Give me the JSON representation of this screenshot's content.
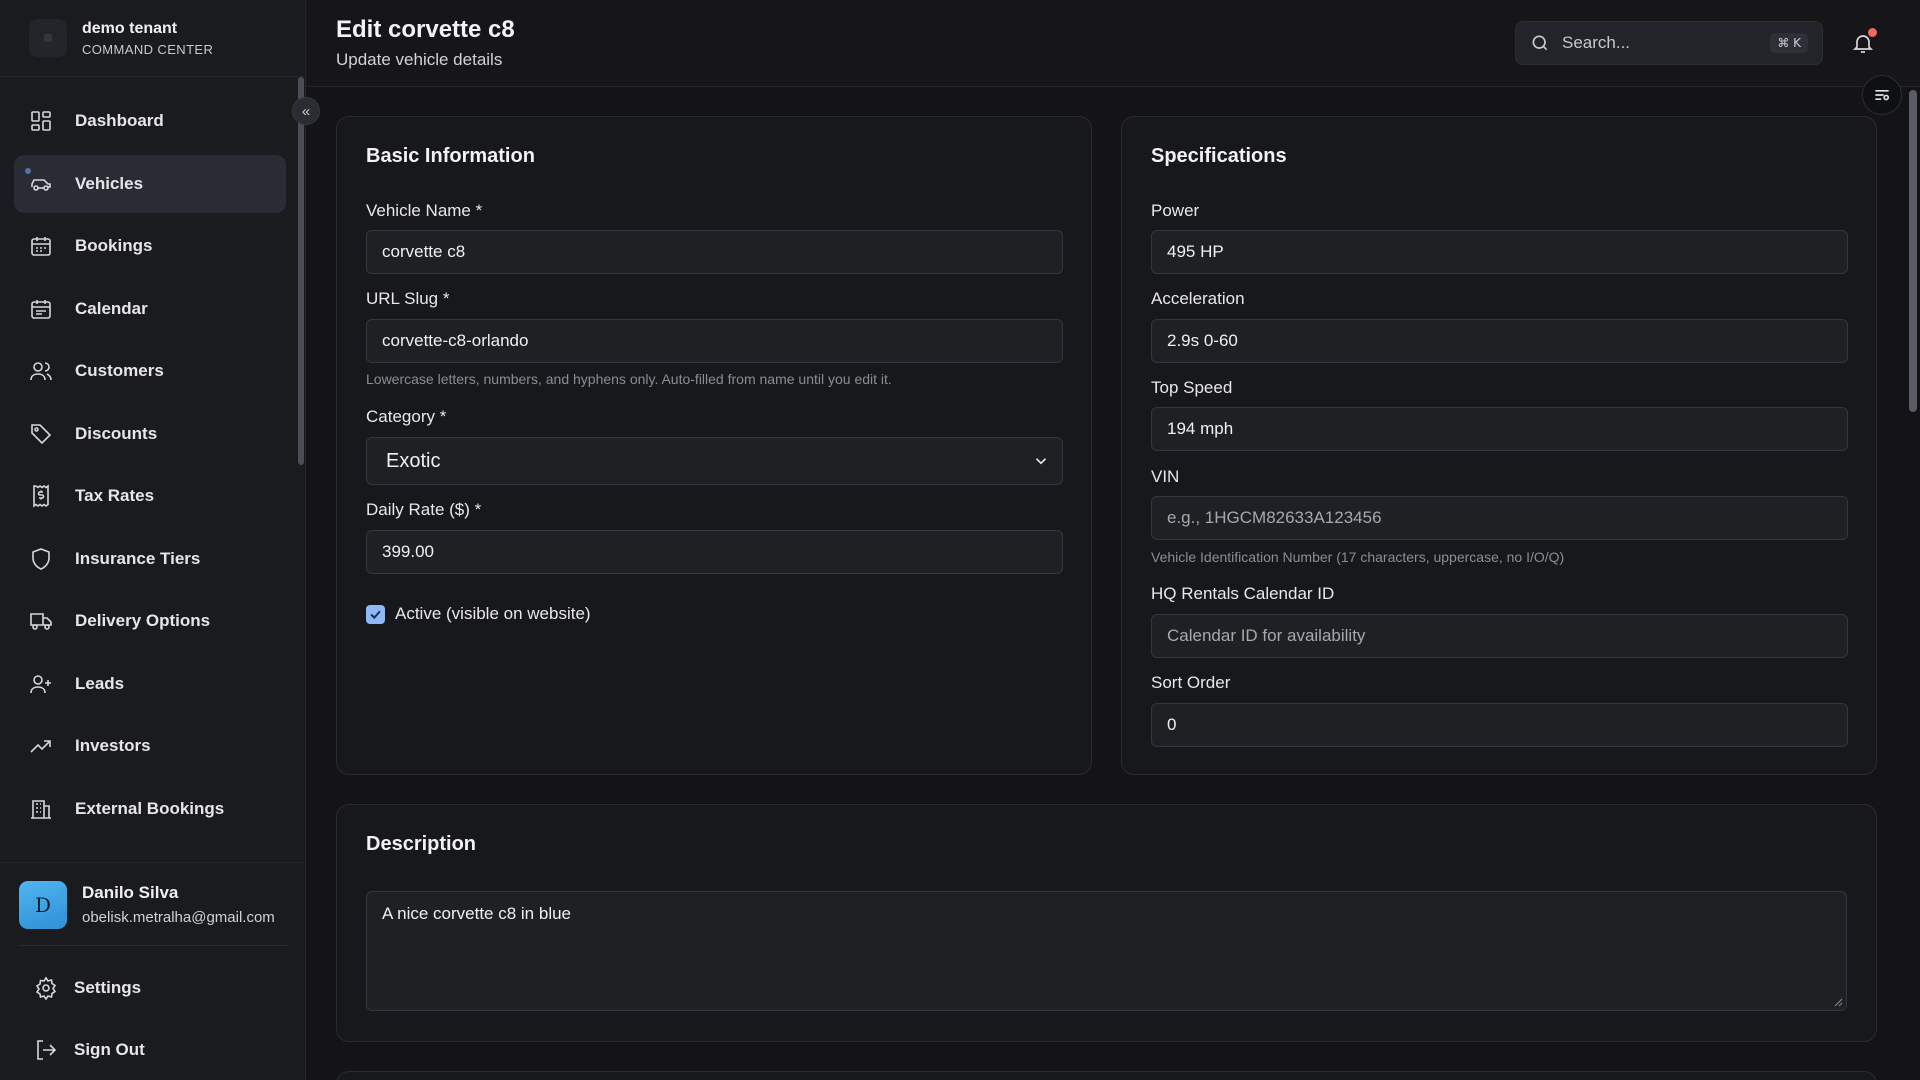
{
  "brand": {
    "name": "demo tenant",
    "subtitle": "COMMAND CENTER"
  },
  "sidebar": {
    "items": [
      {
        "label": "Dashboard",
        "icon": "dashboard-icon"
      },
      {
        "label": "Vehicles",
        "icon": "car-icon",
        "active": true
      },
      {
        "label": "Bookings",
        "icon": "calendar-days-icon"
      },
      {
        "label": "Calendar",
        "icon": "calendar-icon"
      },
      {
        "label": "Customers",
        "icon": "users-icon"
      },
      {
        "label": "Discounts",
        "icon": "tag-icon"
      },
      {
        "label": "Tax Rates",
        "icon": "receipt-icon"
      },
      {
        "label": "Insurance Tiers",
        "icon": "shield-icon"
      },
      {
        "label": "Delivery Options",
        "icon": "truck-icon"
      },
      {
        "label": "Leads",
        "icon": "user-plus-icon"
      },
      {
        "label": "Investors",
        "icon": "trending-up-icon"
      },
      {
        "label": "External Bookings",
        "icon": "building-icon"
      }
    ],
    "collapse_glyph": "«"
  },
  "user": {
    "initial": "D",
    "name": "Danilo Silva",
    "email": "obelisk.metralha@gmail.com"
  },
  "bottom": {
    "settings": "Settings",
    "sign_out": "Sign Out"
  },
  "header": {
    "title": "Edit corvette c8",
    "subtitle": "Update vehicle details",
    "search_placeholder": "Search...",
    "shortcut": "⌘ K"
  },
  "basic": {
    "title": "Basic Information",
    "name_label": "Vehicle Name *",
    "name_value": "corvette c8",
    "slug_label": "URL Slug *",
    "slug_value": "corvette-c8-orlando",
    "slug_hint": "Lowercase letters, numbers, and hyphens only. Auto-filled from name until you edit it.",
    "category_label": "Category *",
    "category_value": "Exotic",
    "rate_label": "Daily Rate ($) *",
    "rate_value": "399.00",
    "active_label": "Active (visible on website)",
    "active_checked": true
  },
  "specs": {
    "title": "Specifications",
    "power_label": "Power",
    "power_value": "495 HP",
    "accel_label": "Acceleration",
    "accel_value": "2.9s 0-60",
    "speed_label": "Top Speed",
    "speed_value": "194 mph",
    "vin_label": "VIN",
    "vin_placeholder": "e.g., 1HGCM82633A123456",
    "vin_hint": "Vehicle Identification Number (17 characters, uppercase, no I/O/Q)",
    "hq_label": "HQ Rentals Calendar ID",
    "hq_placeholder": "Calendar ID for availability",
    "sort_label": "Sort Order",
    "sort_value": "0"
  },
  "description": {
    "title": "Description",
    "value": "A nice corvette c8 in blue"
  },
  "colors": {
    "accent": "#2f8fd6",
    "checkbox": "#8fb8f5",
    "notification": "#f0675f"
  }
}
